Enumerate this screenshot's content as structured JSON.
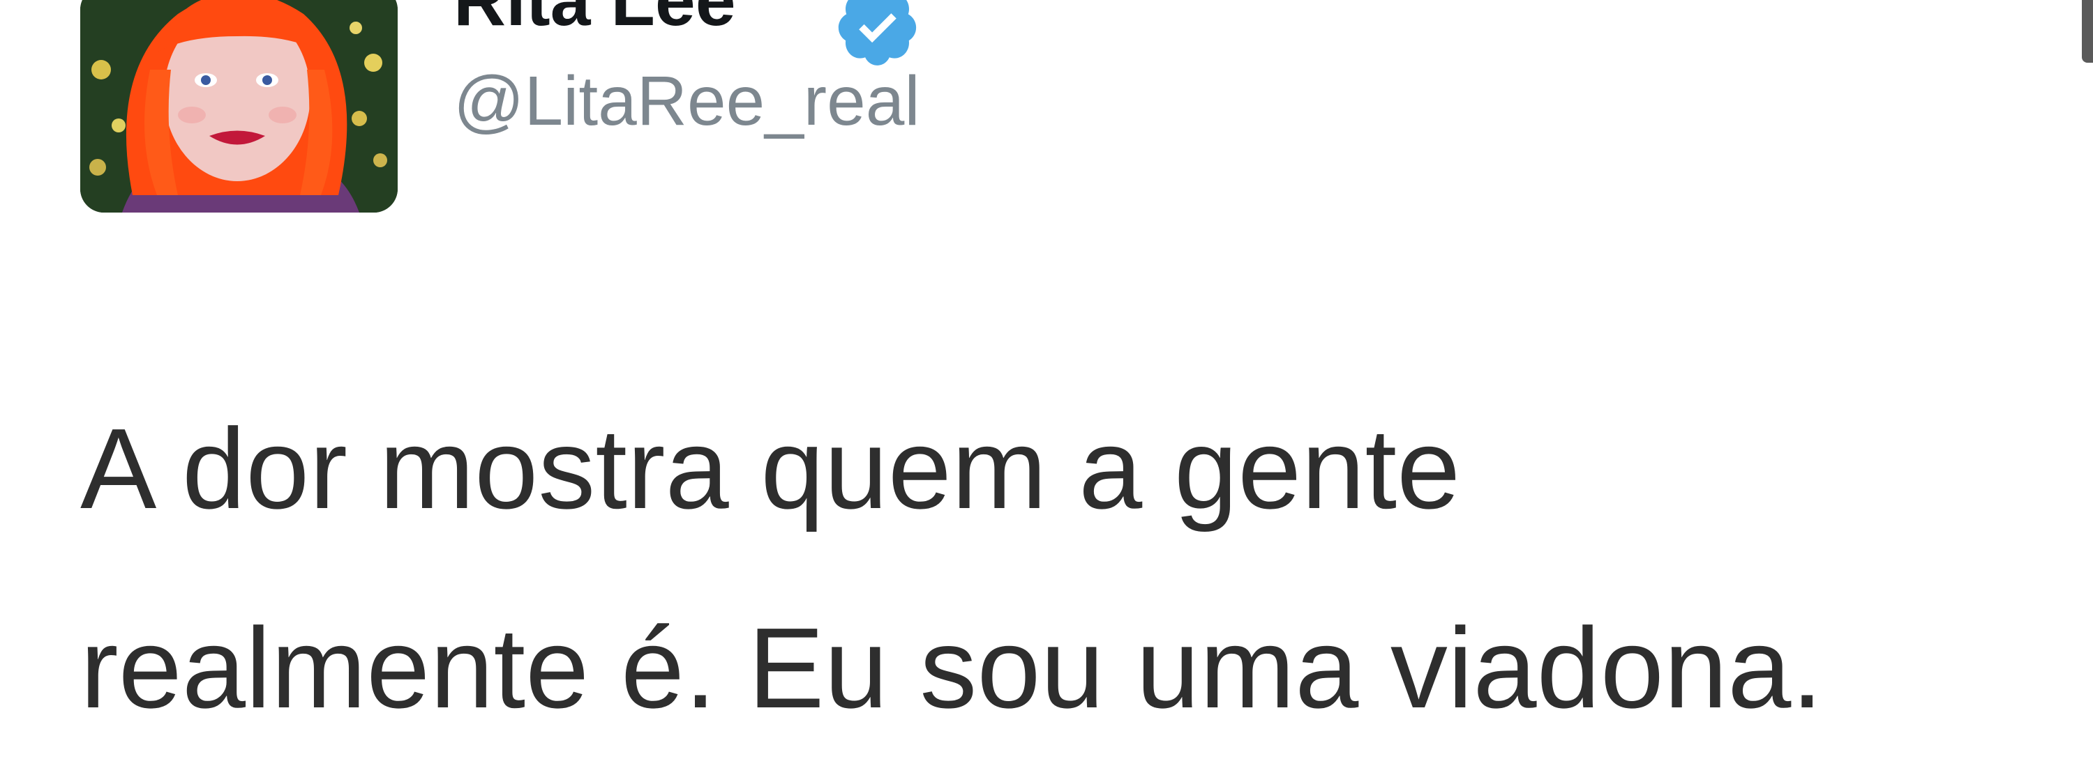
{
  "tweet": {
    "author": {
      "display_name": "Rita Lee",
      "handle": "@LitaRee_real",
      "verified": true,
      "avatar_icon": "avatar-red-hair-portrait"
    },
    "text_lines": [
      "A dor mostra quem a gente",
      "realmente é. Eu sou uma viadona."
    ]
  },
  "colors": {
    "verified_badge": "#4aa8e6",
    "handle": "#7d878f",
    "text": "#2e2e2e",
    "avatar_hair": "#ff4a10"
  }
}
